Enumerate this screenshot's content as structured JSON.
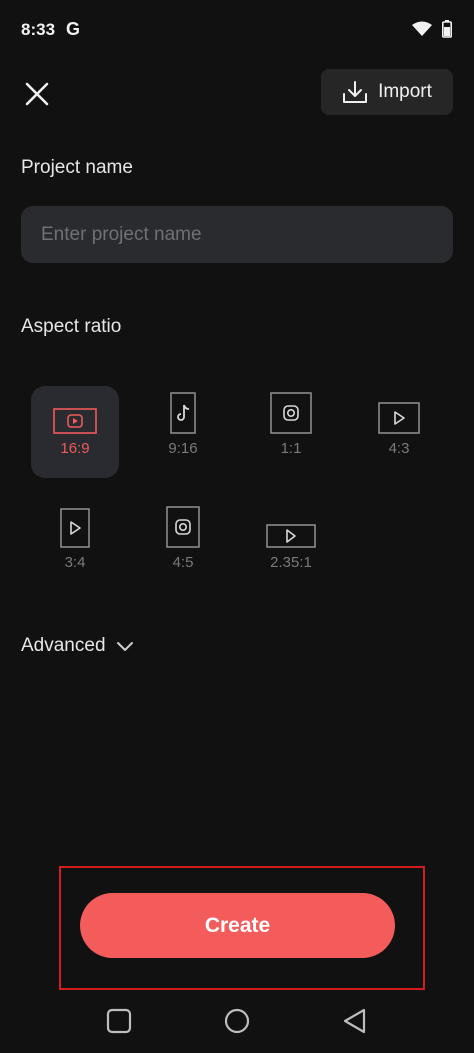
{
  "status_bar": {
    "time": "8:33",
    "g_label": "G"
  },
  "header": {
    "import_label": "Import"
  },
  "project": {
    "label": "Project name",
    "placeholder": "Enter project name",
    "value": ""
  },
  "aspect": {
    "label": "Aspect ratio",
    "selected": "16:9",
    "options": [
      {
        "label": "16:9",
        "icon": "youtube-icon"
      },
      {
        "label": "9:16",
        "icon": "tiktok-icon"
      },
      {
        "label": "1:1",
        "icon": "instagram-icon"
      },
      {
        "label": "4:3",
        "icon": "play-icon"
      },
      {
        "label": "3:4",
        "icon": "play-icon"
      },
      {
        "label": "4:5",
        "icon": "instagram-icon"
      },
      {
        "label": "2.35:1",
        "icon": "play-icon"
      }
    ]
  },
  "advanced": {
    "label": "Advanced"
  },
  "footer": {
    "create_label": "Create"
  },
  "colors": {
    "accent": "#f45c5c",
    "background": "#111111",
    "surface": "#2a2b2f",
    "highlight_border": "#d01e1e"
  }
}
